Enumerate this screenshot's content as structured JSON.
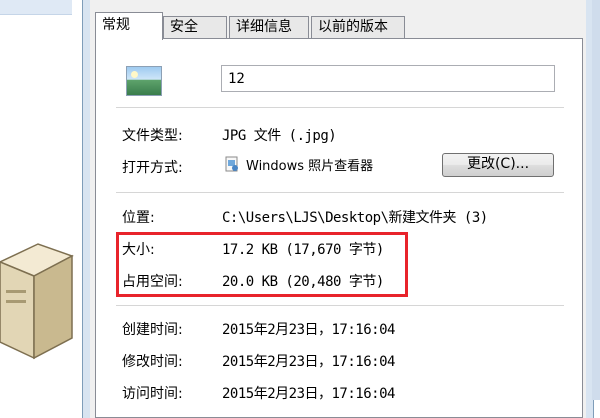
{
  "tabs": [
    {
      "label": "常规",
      "active": true
    },
    {
      "label": "安全",
      "active": false
    },
    {
      "label": "详细信息",
      "active": false
    },
    {
      "label": "以前的版本",
      "active": false
    }
  ],
  "file": {
    "name": "12",
    "type_label": "文件类型:",
    "type_value": "JPG 文件 (.jpg)",
    "open_with_label": "打开方式:",
    "open_with_app": "Windows 照片查看器",
    "change_button": "更改(C)...",
    "location_label": "位置:",
    "location_value": "C:\\Users\\LJS\\Desktop\\新建文件夹 (3)",
    "size_label": "大小:",
    "size_value": "17.2 KB (17,670 字节)",
    "disk_size_label": "占用空间:",
    "disk_size_value": "20.0 KB (20,480 字节)",
    "created_label": "创建时间:",
    "created_value": "2015年2月23日，17:16:04",
    "modified_label": "修改时间:",
    "modified_value": "2015年2月23日，17:16:04",
    "accessed_label": "访问时间:",
    "accessed_value": "2015年2月23日，17:16:04"
  },
  "colors": {
    "highlight": "#e8232b",
    "dialog_frame": "#d8e4f1",
    "panel_bg": "#ffffff"
  },
  "icons": [
    "image-file-icon",
    "photo-viewer-icon",
    "server-box-icon"
  ]
}
